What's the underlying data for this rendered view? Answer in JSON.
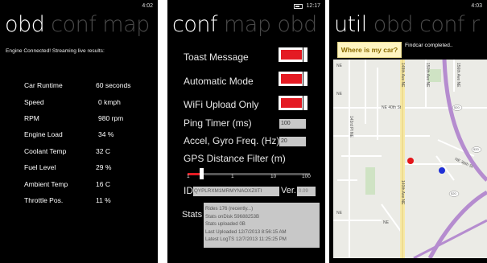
{
  "panel_obd": {
    "time": "4:02",
    "pivot": [
      "obd",
      "conf",
      "map"
    ],
    "status_message": "Engine Connected! Streaming live results:",
    "rows": [
      {
        "label": "Car Runtime",
        "value": "60 seconds"
      },
      {
        "label": "Speed",
        "value": "0 kmph"
      },
      {
        "label": "RPM",
        "value": "980 rpm"
      },
      {
        "label": "Engine Load",
        "value": "34 %"
      },
      {
        "label": "Coolant Temp",
        "value": "32 C"
      },
      {
        "label": "Fuel Level",
        "value": "29 %"
      },
      {
        "label": "Ambient Temp",
        "value": "16 C"
      },
      {
        "label": "Throttle Pos.",
        "value": "11 %"
      }
    ]
  },
  "panel_conf": {
    "time": "12:17",
    "pivot": [
      "conf",
      "map",
      "obd"
    ],
    "toast_label": "Toast Message",
    "auto_label": "Automatic Mode",
    "wifi_label": "WiFi Upload Only",
    "ping_label": "Ping Timer (ms)",
    "ping_value": "100",
    "accel_label": "Accel, Gyro Freq. (Hz)",
    "accel_value": "20",
    "gps_label": "GPS Distance Filter (m)",
    "gps_ticks": [
      "1",
      "1",
      "10",
      "100"
    ],
    "gps_level": 0.1,
    "id_label": "ID",
    "id_value": "QYPLRXM1MRMYNAOXZIITI",
    "ver_label": "Ver.",
    "ver_value": "0.09",
    "stats_label": "Stats",
    "stats_lines": [
      "Rides 176 (recently...)",
      "Stats onDisk 59688253B",
      "Stats uploaded 0B",
      "Last Uploaded 12/7/2013 8:56:15 AM",
      "Latest LogTS 12/7/2013 11:25:25 PM"
    ]
  },
  "panel_util": {
    "time": "4:03",
    "pivot": [
      "util",
      "obd",
      "conf",
      "r"
    ],
    "findcar_button": "Where is my car?",
    "findcar_message": "Findcar completed..",
    "map_labels": {
      "ave_148": "148th Ave NE",
      "ave_150": "150th Ave NE",
      "ave_156": "156th Ave NE",
      "ave_143": "143rd Pl NE",
      "ave_140": "140th Ave NE",
      "st_40": "NE 40th St",
      "st_36": "NE 36th St",
      "route_520_a": "520",
      "route_520_b": "520",
      "route_520_c": "520",
      "ne_1": "NE",
      "ne_2": "NE",
      "ne_3": "NE",
      "ne_4": "NE"
    }
  }
}
